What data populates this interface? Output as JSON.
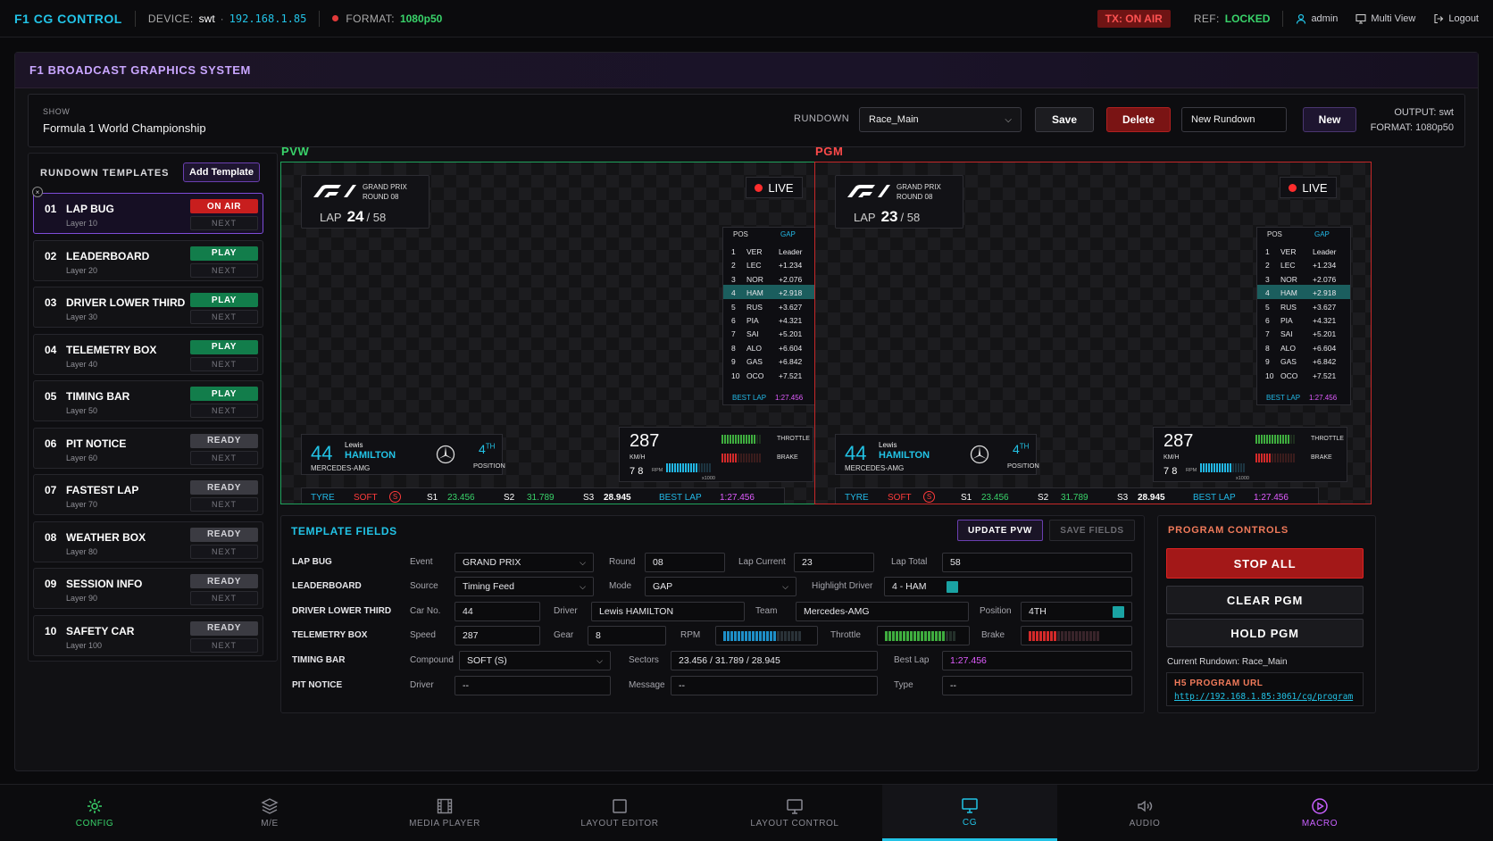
{
  "topbar": {
    "brand": "F1 CG CONTROL",
    "device_label": "DEVICE:",
    "device_name": "swt",
    "device_dot": "·",
    "device_ip": "192.168.1.85",
    "format_label": "FORMAT:",
    "format_value": "1080p50",
    "tx_status": "TX: ON AIR",
    "ref_label": "REF:",
    "ref_value": "LOCKED",
    "user": "admin",
    "multiview": "Multi View",
    "logout": "Logout"
  },
  "header": {
    "title": "F1 BROADCAST GRAPHICS SYSTEM"
  },
  "showbar": {
    "show_label": "SHOW",
    "show_value": "Formula 1 World Championship",
    "rundown_label": "RUNDOWN",
    "rundown_selected": "Race_Main",
    "save": "Save",
    "delete": "Delete",
    "new_rundown_value": "New Rundown",
    "new": "New",
    "output_line": "OUTPUT: swt",
    "format_line": "FORMAT: 1080p50"
  },
  "templates": {
    "title": "RUNDOWN TEMPLATES",
    "add": "Add Template",
    "close_glyph": "×",
    "items": [
      {
        "num": "01",
        "name": "LAP BUG",
        "layer": "Layer 10",
        "status": "ON AIR",
        "next": "NEXT"
      },
      {
        "num": "02",
        "name": "LEADERBOARD",
        "layer": "Layer 20",
        "status": "PLAY",
        "next": "NEXT"
      },
      {
        "num": "03",
        "name": "DRIVER LOWER THIRD",
        "layer": "Layer 30",
        "status": "PLAY",
        "next": "NEXT"
      },
      {
        "num": "04",
        "name": "TELEMETRY BOX",
        "layer": "Layer 40",
        "status": "PLAY",
        "next": "NEXT"
      },
      {
        "num": "05",
        "name": "TIMING BAR",
        "layer": "Layer 50",
        "status": "PLAY",
        "next": "NEXT"
      },
      {
        "num": "06",
        "name": "PIT NOTICE",
        "layer": "Layer 60",
        "status": "READY",
        "next": "NEXT"
      },
      {
        "num": "07",
        "name": "FASTEST LAP",
        "layer": "Layer 70",
        "status": "READY",
        "next": "NEXT"
      },
      {
        "num": "08",
        "name": "WEATHER BOX",
        "layer": "Layer 80",
        "status": "READY",
        "next": "NEXT"
      },
      {
        "num": "09",
        "name": "SESSION INFO",
        "layer": "Layer 90",
        "status": "READY",
        "next": "NEXT"
      },
      {
        "num": "10",
        "name": "SAFETY CAR",
        "layer": "Layer 100",
        "status": "READY",
        "next": "NEXT"
      }
    ]
  },
  "monitors": {
    "pvw_label": "PVW",
    "pgm_label": "PGM",
    "gp_line1": "GRAND PRIX",
    "gp_line2": "ROUND 08",
    "lap_label": "LAP",
    "pvw_lap": "24",
    "pgm_lap": "23",
    "lap_total": "/ 58",
    "live": "LIVE",
    "tower_pos": "POS",
    "tower_gap": "GAP",
    "tower": [
      {
        "pos": "1",
        "drv": "VER",
        "gap": "Leader"
      },
      {
        "pos": "2",
        "drv": "LEC",
        "gap": "+1.234"
      },
      {
        "pos": "3",
        "drv": "NOR",
        "gap": "+2.076"
      },
      {
        "pos": "4",
        "drv": "HAM",
        "gap": "+2.918"
      },
      {
        "pos": "5",
        "drv": "RUS",
        "gap": "+3.627"
      },
      {
        "pos": "6",
        "drv": "PIA",
        "gap": "+4.321"
      },
      {
        "pos": "7",
        "drv": "SAI",
        "gap": "+5.201"
      },
      {
        "pos": "8",
        "drv": "ALO",
        "gap": "+6.604"
      },
      {
        "pos": "9",
        "drv": "GAS",
        "gap": "+6.842"
      },
      {
        "pos": "10",
        "drv": "OCO",
        "gap": "+7.521"
      }
    ],
    "best_lap_label": "BEST LAP",
    "best_lap": "1:27.456",
    "drv_num": "44",
    "drv_first": "Lewis",
    "drv_last": "HAMILTON",
    "drv_team": "MERCEDES-AMG",
    "drv_pos": "4",
    "drv_pos_suffix": "TH",
    "drv_pos_label": "POSITION",
    "speed": "287",
    "kmh": "KM/H",
    "gear": "7",
    "gear_val": "8",
    "rpm_label": "RPM",
    "rpm_scale": "x1000",
    "throttle_label": "THROTTLE",
    "brake_label": "BRAKE",
    "tyre_label": "TYRE",
    "tyre_value": "SOFT",
    "tyre_icon": "S",
    "s1_label": "S1",
    "s1": "23.456",
    "s2_label": "S2",
    "s2": "31.789",
    "s3_label": "S3",
    "s3": "28.945",
    "strip_best_label": "BEST LAP",
    "strip_best": "1:27.456"
  },
  "fields": {
    "title": "TEMPLATE FIELDS",
    "update_pvw": "UPDATE PVW",
    "save_fields": "SAVE FIELDS",
    "lap_bug": {
      "label": "LAP BUG",
      "event_label": "Event",
      "event": "GRAND PRIX",
      "round_label": "Round",
      "round": "08",
      "lap_cur_label": "Lap Current",
      "lap_cur": "23",
      "lap_total_label": "Lap Total",
      "lap_total": "58"
    },
    "leaderboard": {
      "label": "LEADERBOARD",
      "source_label": "Source",
      "source": "Timing Feed",
      "mode_label": "Mode",
      "mode": "GAP",
      "hl_label": "Highlight Driver",
      "hl": "4 - HAM"
    },
    "lower_third": {
      "label": "DRIVER LOWER THIRD",
      "carno_label": "Car No.",
      "carno": "44",
      "driver_label": "Driver",
      "driver": "Lewis HAMILTON",
      "team_label": "Team",
      "team": "Mercedes-AMG",
      "position_label": "Position",
      "position": "4TH"
    },
    "telemetry": {
      "label": "TELEMETRY BOX",
      "speed_label": "Speed",
      "speed": "287",
      "gear_label": "Gear",
      "gear": "8",
      "rpm_label": "RPM",
      "throttle_label": "Throttle",
      "brake_label": "Brake"
    },
    "timing": {
      "label": "TIMING BAR",
      "compound_label": "Compound",
      "compound": "SOFT (S)",
      "sectors_label": "Sectors",
      "sectors": "23.456 / 31.789 / 28.945",
      "best_label": "Best Lap",
      "best": "1:27.456"
    },
    "pit": {
      "label": "PIT NOTICE",
      "driver_label": "Driver",
      "driver": "--",
      "message_label": "Message",
      "message": "--",
      "type_label": "Type",
      "type": "--"
    }
  },
  "program": {
    "title": "PROGRAM CONTROLS",
    "stop_all": "STOP ALL",
    "clear_pgm": "CLEAR PGM",
    "hold_pgm": "HOLD PGM",
    "current_rundown": "Current Rundown: Race_Main",
    "h5_title": "H5 PROGRAM URL",
    "h5_url": "http://192.168.1.85:3061/cg/program"
  },
  "nav": {
    "items": [
      {
        "label": "CONFIG",
        "icon": "gear-icon"
      },
      {
        "label": "M/E",
        "icon": "layers-icon"
      },
      {
        "label": "MEDIA PLAYER",
        "icon": "film-icon"
      },
      {
        "label": "LAYOUT EDITOR",
        "icon": "square-icon"
      },
      {
        "label": "LAYOUT CONTROL",
        "icon": "monitor-icon"
      },
      {
        "label": "CG",
        "icon": "monitor-icon"
      },
      {
        "label": "AUDIO",
        "icon": "speaker-icon"
      },
      {
        "label": "MACRO",
        "icon": "play-circle-icon"
      }
    ]
  },
  "colors": {
    "accent_cyan": "#22c3e6",
    "onair_red": "#c81e1e",
    "play_green": "#127d4b",
    "pvw_border": "#1fa35c",
    "pgm_border": "#c62828",
    "purple": "#7d4cd9"
  },
  "meters": {
    "rpm_fraction": 0.7,
    "throttle_fraction": 0.85,
    "brake_fraction": 0.4
  }
}
